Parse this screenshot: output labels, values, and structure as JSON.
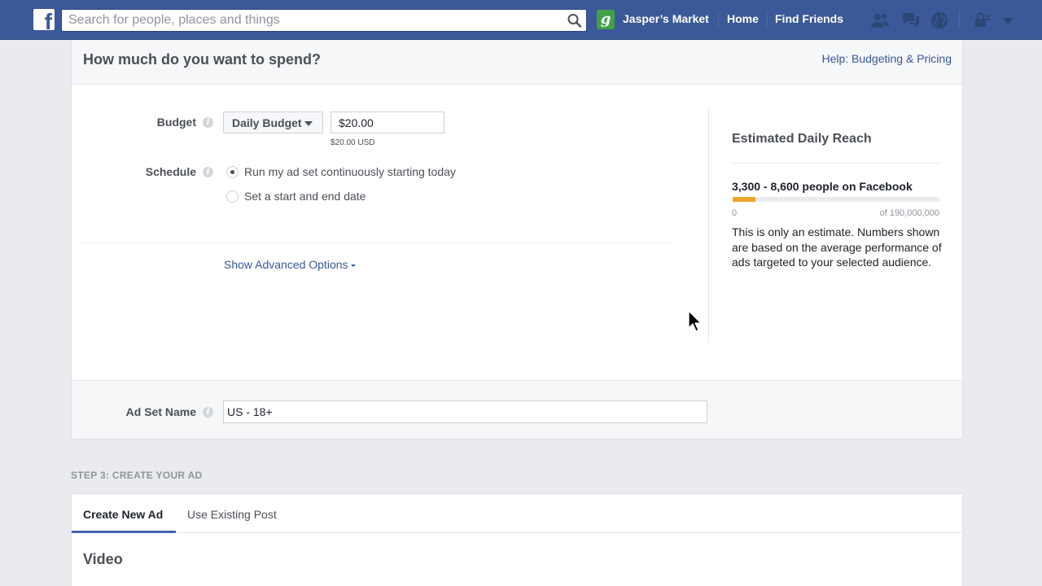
{
  "topbar": {
    "search_placeholder": "Search for people, places and things",
    "page_badge": "g",
    "page_name": "Jasper’s Market",
    "home": "Home",
    "find_friends": "Find Friends"
  },
  "spend": {
    "title": "How much do you want to spend?",
    "help_link": "Help: Budgeting & Pricing",
    "budget_label": "Budget",
    "budget_type": "Daily Budget",
    "budget_value": "$20.00",
    "budget_usd": "$20.00 USD",
    "schedule_label": "Schedule",
    "schedule_options": [
      {
        "label": "Run my ad set continuously starting today",
        "selected": true
      },
      {
        "label": "Set a start and end date",
        "selected": false
      }
    ],
    "advanced_link": "Show Advanced Options",
    "adset_name_label": "Ad Set Name",
    "adset_name_value": "US - 18+"
  },
  "reach": {
    "title": "Estimated Daily Reach",
    "range": "3,300 - 8,600 people on Facebook",
    "bar_fill_fraction": 0.11,
    "min": "0",
    "max": "of 190,000,000",
    "note": "This is only an estimate. Numbers shown are based on the average performance of ads targeted to your selected audience."
  },
  "step3": {
    "label": "STEP 3: CREATE YOUR AD",
    "tabs": [
      "Create New Ad",
      "Use Existing Post"
    ],
    "active_tab": 0,
    "section_title": "Video"
  },
  "info_icon_glyph": "i",
  "colors": {
    "topbar": "#3b5998",
    "link": "#365899",
    "reach_fill": "#f0a42b",
    "tab_underline": "#4267b2"
  },
  "icons": [
    "facebook-logo-icon",
    "search-icon",
    "friend-requests-icon",
    "messages-icon",
    "notifications-globe-icon",
    "privacy-lock-icon",
    "account-menu-caret-icon",
    "mouse-cursor-icon"
  ]
}
